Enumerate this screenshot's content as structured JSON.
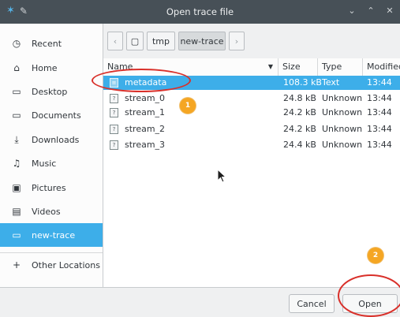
{
  "window": {
    "title": "Open trace file",
    "controls": [
      "chevron-down-icon",
      "chevron-up-icon",
      "close-icon"
    ]
  },
  "sidebar": {
    "items": [
      {
        "label": "Recent",
        "icon": "clock-icon"
      },
      {
        "label": "Home",
        "icon": "home-icon"
      },
      {
        "label": "Desktop",
        "icon": "desktop-folder-icon"
      },
      {
        "label": "Documents",
        "icon": "documents-folder-icon"
      },
      {
        "label": "Downloads",
        "icon": "download-icon"
      },
      {
        "label": "Music",
        "icon": "music-icon"
      },
      {
        "label": "Pictures",
        "icon": "pictures-icon"
      },
      {
        "label": "Videos",
        "icon": "video-icon"
      },
      {
        "label": "new-trace",
        "icon": "folder-icon",
        "active": true
      },
      {
        "label": "Other Locations",
        "icon": "plus-icon"
      }
    ]
  },
  "pathbar": {
    "segments": [
      "tmp",
      "new-trace"
    ],
    "active": "new-trace"
  },
  "filelist": {
    "columns": [
      "Name",
      "Size",
      "Type",
      "Modified"
    ],
    "sort_indicator": "▼",
    "rows": [
      {
        "name": "metadata",
        "size": "108.3 kB",
        "type": "Text",
        "modified": "13:44",
        "selected": true
      },
      {
        "name": "stream_0",
        "size": "24.8 kB",
        "type": "Unknown",
        "modified": "13:44"
      },
      {
        "name": "stream_1",
        "size": "24.2 kB",
        "type": "Unknown",
        "modified": "13:44"
      },
      {
        "name": "stream_2",
        "size": "24.2 kB",
        "type": "Unknown",
        "modified": "13:44"
      },
      {
        "name": "stream_3",
        "size": "24.4 kB",
        "type": "Unknown",
        "modified": "13:44"
      }
    ]
  },
  "buttons": {
    "cancel": "Cancel",
    "open": "Open"
  },
  "annotations": {
    "badge1": "1",
    "badge2": "2",
    "accent": "#f5a623",
    "ring_color": "#d9302a"
  },
  "colors": {
    "selection": "#3daee9",
    "titlebar": "#475057"
  }
}
